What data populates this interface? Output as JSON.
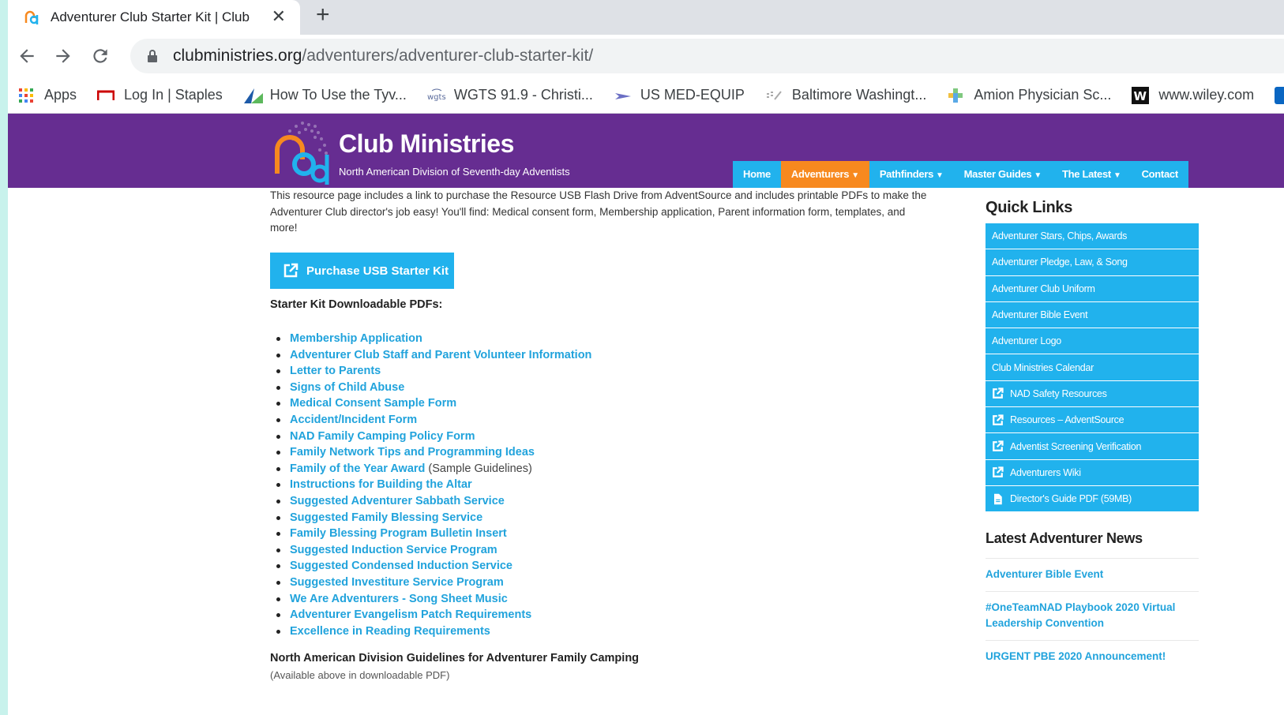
{
  "browser": {
    "tab_title": "Adventurer Club Starter Kit | Club",
    "url_host": "clubministries.org",
    "url_path": "/adventurers/adventurer-club-starter-kit/",
    "bookmarks": [
      {
        "label": "Apps",
        "icon": "apps-grid-icon"
      },
      {
        "label": "Log In | Staples",
        "icon": "staples-icon"
      },
      {
        "label": "How To Use the Tyv...",
        "icon": "tyvek-icon"
      },
      {
        "label": "WGTS 91.9 - Christi...",
        "icon": "wgts-icon"
      },
      {
        "label": "US MED-EQUIP",
        "icon": "plane-icon"
      },
      {
        "label": "Baltimore Washingt...",
        "icon": "baltimore-icon"
      },
      {
        "label": "Amion Physician Sc...",
        "icon": "amion-icon"
      },
      {
        "label": "www.wiley.com",
        "icon": "wiley-icon"
      }
    ]
  },
  "site": {
    "brand_title": "Club Ministries",
    "brand_subtitle": "North American Division of Seventh-day Adventists",
    "nav": [
      "Home",
      "Adventurers",
      "Pathfinders",
      "Master Guides",
      "The Latest",
      "Contact"
    ],
    "colors": {
      "purple": "#662d91",
      "blue": "#21b2ed",
      "orange": "#f7891f",
      "link": "#21a3dc"
    }
  },
  "content": {
    "intro": "This resource page includes a link to purchase the Resource USB Flash Drive from AdventSource and includes printable PDFs to make the Adventurer Club director's job easy! You'll find: Medical consent form, Membership application, Parent information form, templates, and more!",
    "buy_button": "Purchase USB Starter Kit",
    "pdfs_heading": "Starter Kit Downloadable PDFs:",
    "pdfs": [
      {
        "label": "Membership Application"
      },
      {
        "label": "Adventurer Club Staff and Parent Volunteer Information"
      },
      {
        "label": "Letter to Parents"
      },
      {
        "label": "Signs of Child Abuse"
      },
      {
        "label": "Medical Consent Sample Form"
      },
      {
        "label": "Accident/Incident Form"
      },
      {
        "label": "NAD Family Camping Policy Form"
      },
      {
        "label": "Family Network Tips and Programming Ideas"
      },
      {
        "label": "Family of the Year Award",
        "note": " (Sample Guidelines)"
      },
      {
        "label": "Instructions for Building the Altar"
      },
      {
        "label": "Suggested Adventurer Sabbath Service"
      },
      {
        "label": "Suggested Family Blessing Service"
      },
      {
        "label": "Family Blessing Program Bulletin Insert"
      },
      {
        "label": "Suggested Induction Service Program"
      },
      {
        "label": "Suggested Condensed Induction Service"
      },
      {
        "label": "Suggested Investiture Service Program"
      },
      {
        "label": "We Are Adventurers - Song Sheet Music"
      },
      {
        "label": "Adventurer Evangelism Patch Requirements"
      },
      {
        "label": "Excellence in Reading Requirements"
      }
    ],
    "guidelines_heading": "North American Division Guidelines for Adventurer Family Camping",
    "guidelines_note": "(Available above in downloadable PDF)"
  },
  "sidebar": {
    "quick_links_heading": "Quick Links",
    "quick_links": [
      {
        "label": "Adventurer Stars, Chips, Awards",
        "icon": ""
      },
      {
        "label": "Adventurer Pledge, Law, & Song",
        "icon": ""
      },
      {
        "label": "Adventurer Club Uniform",
        "icon": ""
      },
      {
        "label": "Adventurer Bible Event",
        "icon": ""
      },
      {
        "label": "Adventurer Logo",
        "icon": ""
      },
      {
        "label": "Club Ministries Calendar",
        "icon": ""
      },
      {
        "label": "NAD Safety Resources",
        "icon": "external-link-icon"
      },
      {
        "label": "Resources – AdventSource",
        "icon": "external-link-icon"
      },
      {
        "label": "Adventist Screening Verification",
        "icon": "external-link-icon"
      },
      {
        "label": "Adventurers Wiki",
        "icon": "external-link-icon"
      },
      {
        "label": "Director's Guide PDF (59MB)",
        "icon": "pdf-file-icon"
      }
    ],
    "news_heading": "Latest Adventurer News",
    "news": [
      "Adventurer Bible Event",
      "#OneTeamNAD Playbook 2020 Virtual Leadership Convention",
      "URGENT PBE 2020 Announcement!"
    ]
  }
}
